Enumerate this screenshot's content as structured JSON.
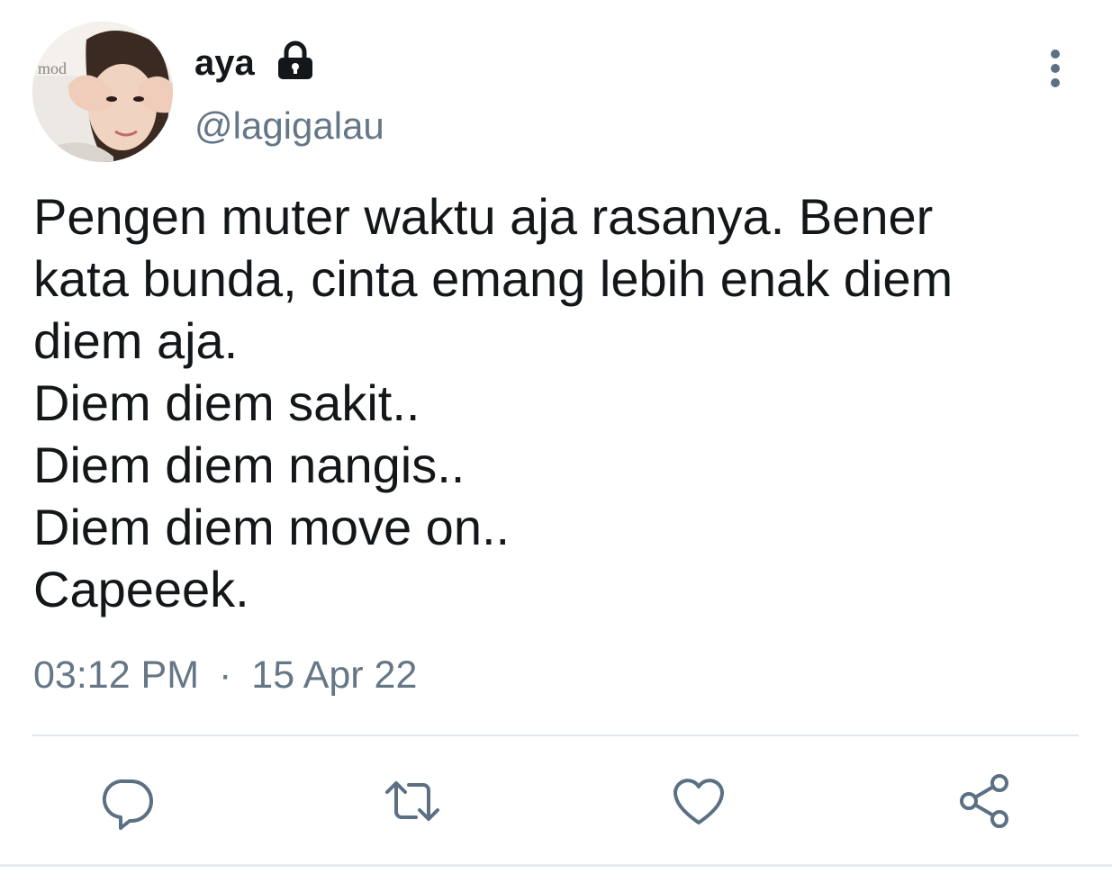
{
  "tweet": {
    "author": {
      "display_name": "aya",
      "handle": "@lagigalau",
      "avatar_icon": "user-photo-avatar",
      "protected_icon": "lock-icon"
    },
    "text_lines": [
      "Pengen muter waktu aja rasanya. Bener",
      "kata bunda, cinta emang lebih enak diem",
      "diem aja.",
      "Diem diem sakit..",
      "Diem diem nangis..",
      "Diem diem move on..",
      "Capeeek."
    ],
    "time": "03:12 PM",
    "separator": "·",
    "date": "15 Apr 22",
    "actions": {
      "reply_icon": "reply-icon",
      "retweet_icon": "retweet-icon",
      "like_icon": "heart-icon",
      "share_icon": "share-icon"
    },
    "more_icon": "more-vertical-icon"
  },
  "colors": {
    "text_primary": "#14171a",
    "text_secondary": "#657786",
    "icon_gray": "#5b7083",
    "divider": "#e1e8ed"
  }
}
